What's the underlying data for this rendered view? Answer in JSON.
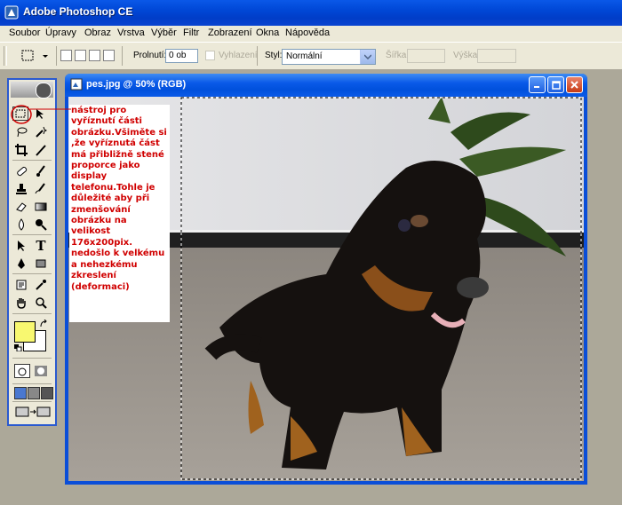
{
  "app": {
    "title": "Adobe Photoshop CE",
    "icon": "photoshop-icon"
  },
  "menu": [
    "Soubor",
    "Úpravy",
    "Obraz",
    "Vrstva",
    "Výběr",
    "Filtr",
    "Zobrazení",
    "Okna",
    "Nápověda"
  ],
  "options": {
    "feather_label": "Prolnutí:",
    "feather_value": "0 ob",
    "antialias_label": "Vyhlazení",
    "style_label": "Styl:",
    "style_value": "Normální",
    "width_label": "Šířka:",
    "height_label": "Výška:"
  },
  "document": {
    "title": "pes.jpg @ 50% (RGB)",
    "icon": "document-icon"
  },
  "annotation": {
    "text": "nástroj pro vyříznutí části obrázku.Všiměte si ,že vyříznutá část má přibližně stené proporce jako display telefonu.Tohle je důležité aby při zmenšování obrázku na velikost 176x200pix. nedošlo k velkému a nehezkému zkreslení (deformaci)",
    "color": "#D00000"
  },
  "colors": {
    "foreground": "#F8F870",
    "background": "#FFFFFF",
    "accent": "#0A4ED8"
  }
}
